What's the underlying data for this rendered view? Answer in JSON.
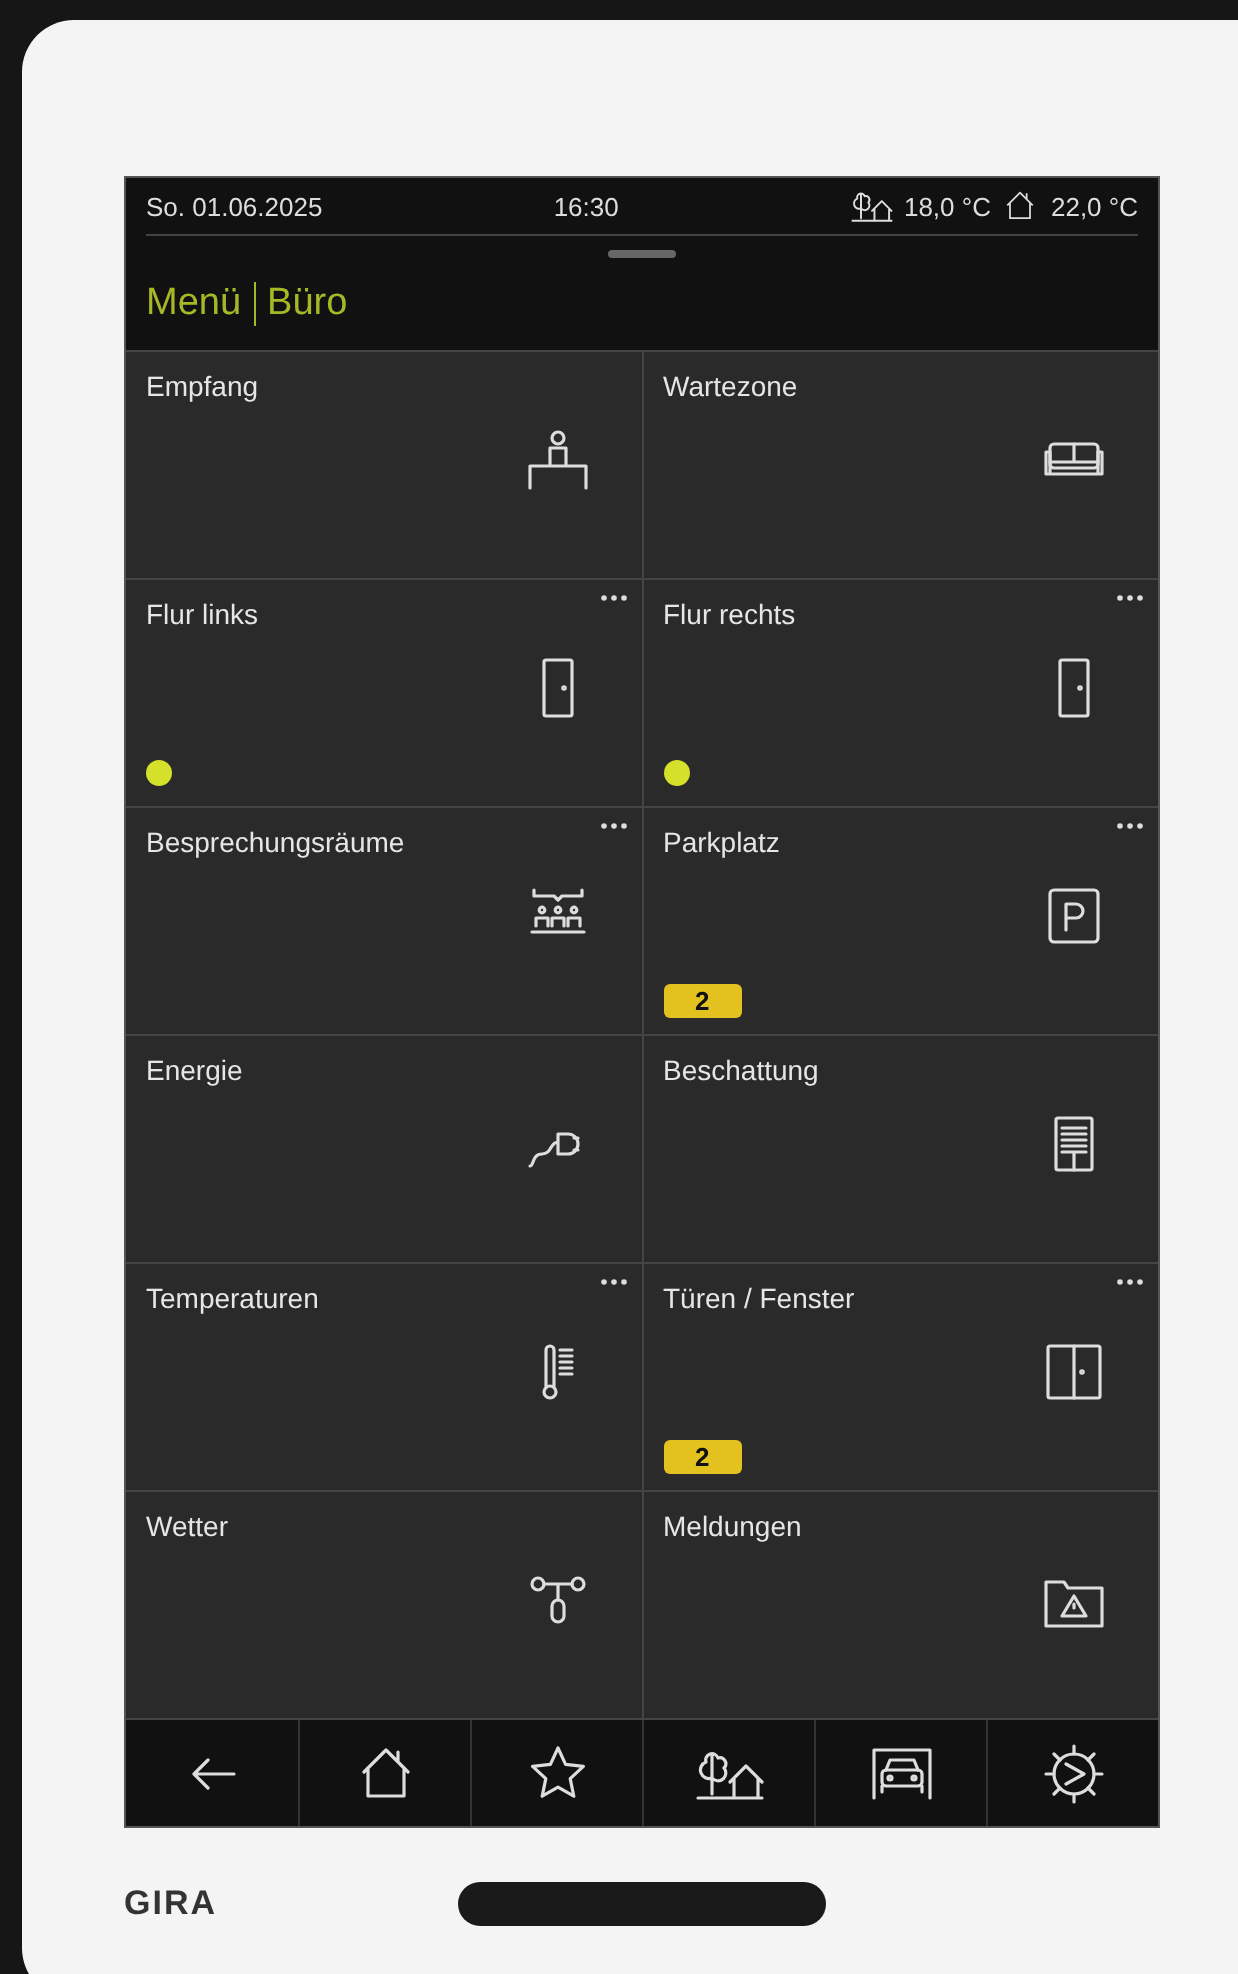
{
  "status_bar": {
    "date": "So. 01.06.2025",
    "time": "16:30",
    "outdoor_temperature": "18,0 °C",
    "indoor_temperature": "22,0 °C"
  },
  "header": {
    "breadcrumb": [
      "Menü",
      "Büro"
    ]
  },
  "tiles": [
    {
      "label": "Empfang",
      "menu": false,
      "led": false
    },
    {
      "label": "Wartezone",
      "menu": false,
      "led": false
    },
    {
      "label": "Flur links",
      "menu": true,
      "led": true
    },
    {
      "label": "Flur rechts",
      "menu": true,
      "led": true
    },
    {
      "label": "Besprechungsräume",
      "menu": true,
      "led": false
    },
    {
      "label": "Parkplatz",
      "menu": true,
      "led": false,
      "badge": "2"
    },
    {
      "label": "Energie",
      "menu": false,
      "led": false
    },
    {
      "label": "Beschattung",
      "menu": false,
      "led": false
    },
    {
      "label": "Temperaturen",
      "menu": true,
      "led": false
    },
    {
      "label": "Türen / Fenster",
      "menu": true,
      "led": false,
      "badge": "2"
    },
    {
      "label": "Wetter",
      "menu": false,
      "led": false
    },
    {
      "label": "Meldungen",
      "menu": false,
      "led": false
    }
  ],
  "device": {
    "brand": "GIRA"
  }
}
